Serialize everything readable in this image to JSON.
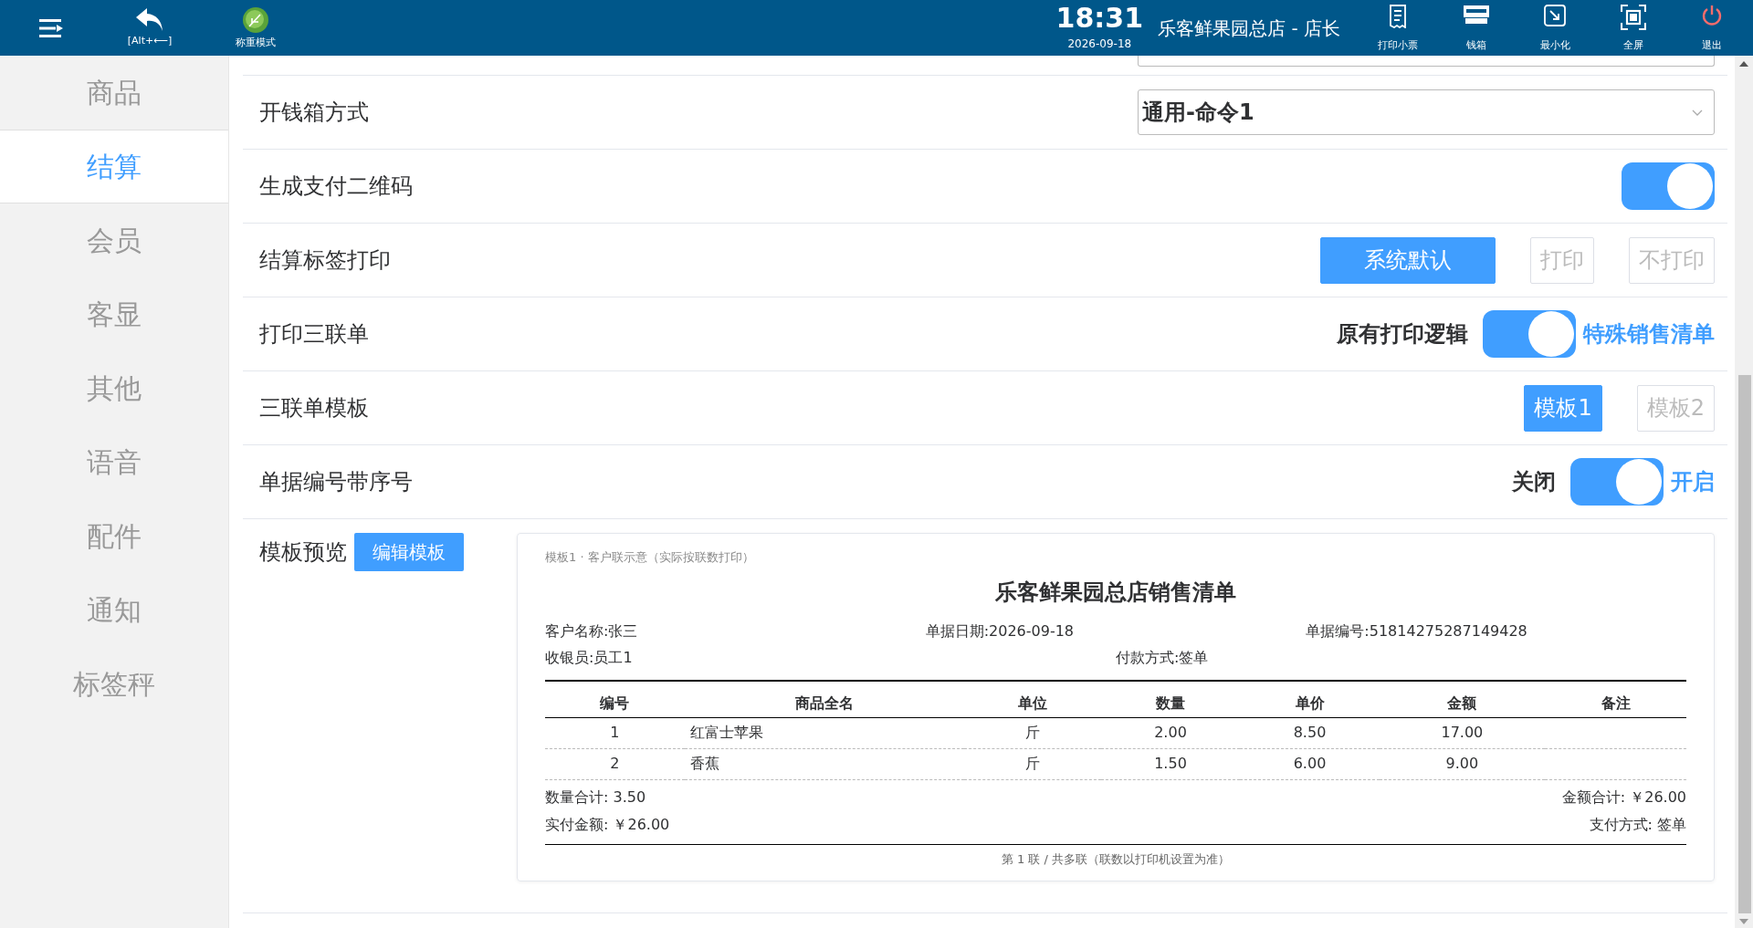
{
  "top_bar": {
    "left_tools": [
      {
        "kind": "back",
        "label": "[Alt+⟵]"
      },
      {
        "kind": "scale",
        "label": "称重模式"
      }
    ],
    "clock": {
      "time": "18:31",
      "date": "2026-09-18"
    },
    "store": "乐客鲜果园总店 - 店长",
    "right_tools": [
      {
        "kind": "receipt",
        "label": "打印小票"
      },
      {
        "kind": "drawer",
        "label": "钱箱"
      },
      {
        "kind": "minimize",
        "label": "最小化"
      },
      {
        "kind": "fullscreen",
        "label": "全屏"
      },
      {
        "kind": "power",
        "label": "退出"
      }
    ]
  },
  "sidebar": {
    "items": [
      {
        "label": "商品",
        "selected": false
      },
      {
        "label": "结算",
        "selected": true
      },
      {
        "label": "会员",
        "selected": false
      },
      {
        "label": "客显",
        "selected": false
      },
      {
        "label": "其他",
        "selected": false
      },
      {
        "label": "语音",
        "selected": false
      },
      {
        "label": "配件",
        "selected": false
      },
      {
        "label": "通知",
        "selected": false
      },
      {
        "label": "标签秤",
        "selected": false
      }
    ]
  },
  "settings": [
    {
      "kind": "select",
      "label": "开钱箱方式",
      "value": "通用-命令1"
    },
    {
      "kind": "toggle",
      "label": "生成支付二维码",
      "on": true
    },
    {
      "kind": "options",
      "label": "结算标签打印",
      "options": [
        {
          "label": "系统默认",
          "selected": true
        },
        {
          "label": "打印",
          "selected": false
        },
        {
          "label": "不打印",
          "selected": false
        }
      ]
    },
    {
      "kind": "labeled_toggle",
      "label": "打印三联单",
      "off_label": "原有打印逻辑",
      "on_label": "特殊销售清单",
      "on": true
    },
    {
      "kind": "options",
      "label": "三联单模板",
      "options": [
        {
          "label": "模板1",
          "selected": true
        },
        {
          "label": "模板2",
          "selected": false
        }
      ]
    },
    {
      "kind": "labeled_toggle",
      "label": "单据编号带序号",
      "off_label": "关闭",
      "on_label": "开启",
      "on": true
    }
  ],
  "preview": {
    "label": "模板预览",
    "button": "编辑模板",
    "receipt": {
      "note": "模板1 · 客户联示意（实际按联数打印）",
      "title": "乐客鲜果园总店销售清单",
      "meta": [
        [
          "客户名称:张三",
          "单据日期:2026-09-18",
          "单据编号:51814275287149428"
        ],
        [
          "收银员:员工1",
          "付款方式:签单"
        ]
      ],
      "columns": [
        "编号",
        "商品全名",
        "单位",
        "数量",
        "单价",
        "金额",
        "备注"
      ],
      "rows": [
        [
          "1",
          "红富士苹果",
          "斤",
          "2.00",
          "8.50",
          "17.00",
          ""
        ],
        [
          "2",
          "香蕉",
          "斤",
          "1.50",
          "6.00",
          "9.00",
          ""
        ]
      ],
      "totals_left": [
        "数量合计: 3.50",
        "实付金额: ￥26.00"
      ],
      "totals_right": [
        "金额合计: ￥26.00",
        "支付方式: 签单"
      ],
      "footnote": "第 1 联 / 共多联（联数以打印机设置为准）"
    }
  }
}
